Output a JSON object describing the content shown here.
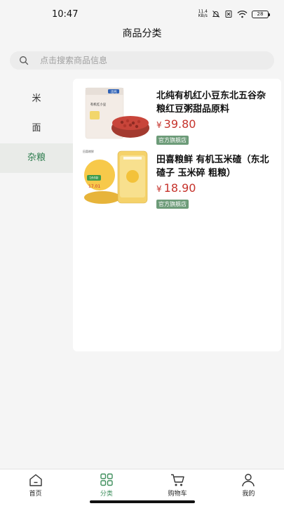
{
  "status_bar": {
    "time": "10:47",
    "net_speed_value": "11.4",
    "net_speed_unit": "KB/s",
    "battery": "28"
  },
  "header": {
    "title": "商品分类"
  },
  "search": {
    "placeholder": "点击搜索商品信息"
  },
  "sidebar": {
    "items": [
      {
        "label": "米",
        "active": false
      },
      {
        "label": "面",
        "active": false
      },
      {
        "label": "杂粮",
        "active": true
      }
    ]
  },
  "products": [
    {
      "title": "北纯有机红小豆东北五谷杂粮红豆粥甜品原料",
      "currency": "¥",
      "price": "39.80",
      "tag": "官方旗舰店",
      "thumb_texts": {
        "brand": "北纯",
        "label": "有机红小豆"
      }
    },
    {
      "title": "田喜粮鲜 有机玉米碴（东北碴子 玉米碎 粗粮）",
      "currency": "¥",
      "price": "18.90",
      "tag": "官方旗舰店",
      "thumb_texts": {
        "brand": "田喜粮鲜",
        "promo": "1件9折",
        "promo_price": "17.01"
      }
    }
  ],
  "tabbar": {
    "items": [
      {
        "label": "首页",
        "icon": "home-icon",
        "active": false
      },
      {
        "label": "分类",
        "icon": "category-grid-icon",
        "active": true
      },
      {
        "label": "购物车",
        "icon": "cart-icon",
        "active": false
      },
      {
        "label": "我的",
        "icon": "user-icon",
        "active": false
      }
    ]
  },
  "colors": {
    "accent": "#3f8f5d",
    "price": "#c6332c",
    "tag_bg": "#6c9b78",
    "sidebar_active_bg": "#e9ebe8"
  }
}
